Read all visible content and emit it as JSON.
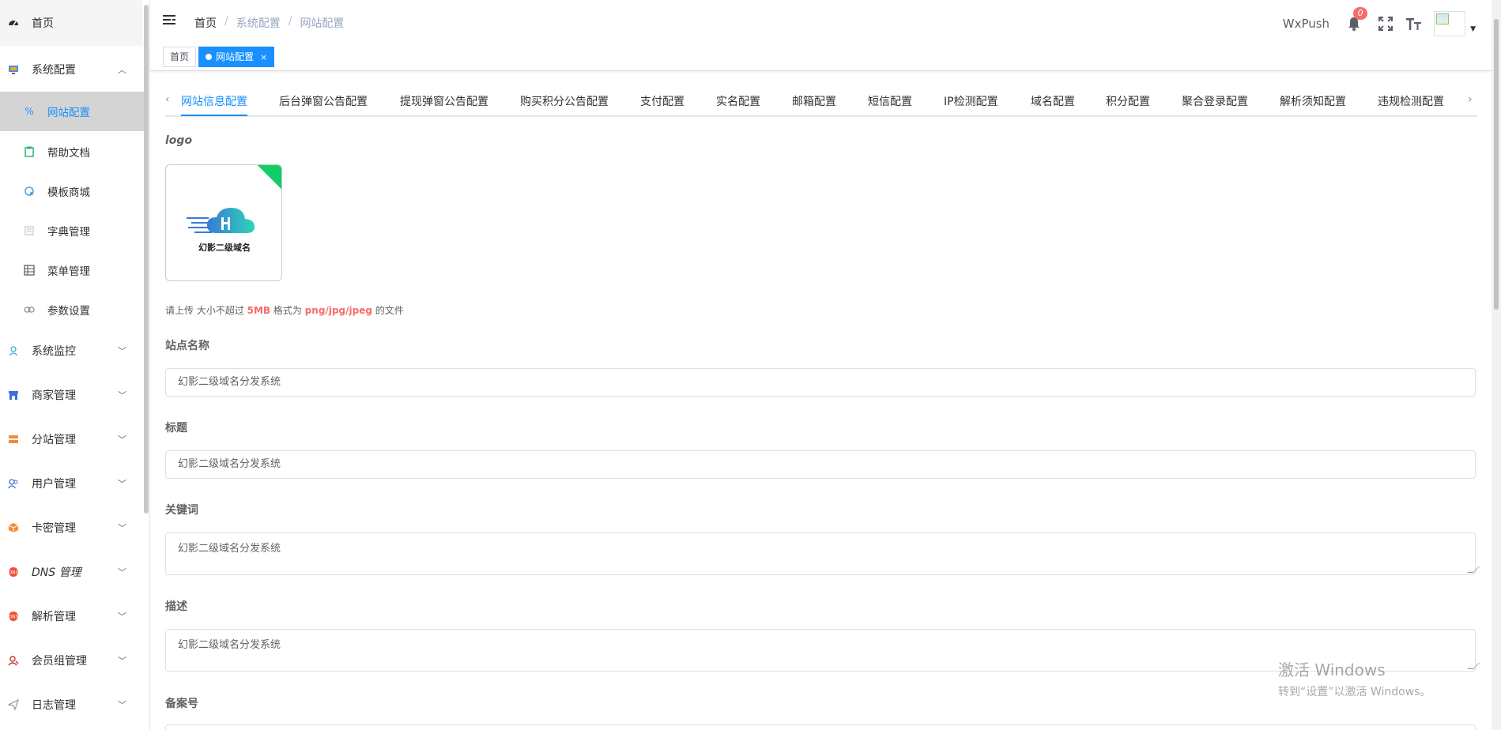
{
  "sidebar": {
    "items": [
      {
        "label": "首页",
        "icon": "dashboard-icon"
      },
      {
        "label": "系统配置",
        "icon": "monitor-icon",
        "expanded": true
      },
      {
        "label": "网站配置",
        "icon": "percent-icon",
        "active": true
      },
      {
        "label": "帮助文档",
        "icon": "clipboard-icon"
      },
      {
        "label": "模板商城",
        "icon": "shopping-icon"
      },
      {
        "label": "字典管理",
        "icon": "dictionary-icon"
      },
      {
        "label": "菜单管理",
        "icon": "table-icon"
      },
      {
        "label": "参数设置",
        "icon": "link-icon"
      },
      {
        "label": "系统监控",
        "icon": "monitor-user-icon"
      },
      {
        "label": "商家管理",
        "icon": "store-icon"
      },
      {
        "label": "分站管理",
        "icon": "server-icon"
      },
      {
        "label": "用户管理",
        "icon": "users-icon"
      },
      {
        "label": "卡密管理",
        "icon": "cube-icon"
      },
      {
        "label": "DNS 管理",
        "icon": "dns-icon"
      },
      {
        "label": "解析管理",
        "icon": "dns-resolve-icon"
      },
      {
        "label": "会员组管理",
        "icon": "member-icon"
      },
      {
        "label": "日志管理",
        "icon": "log-icon"
      }
    ]
  },
  "breadcrumb": [
    "首页",
    "系统配置",
    "网站配置"
  ],
  "header": {
    "wxpush": "WxPush",
    "badge": "0"
  },
  "tags": [
    {
      "label": "首页"
    },
    {
      "label": "网站配置",
      "close": "×"
    }
  ],
  "subtabs": [
    "网站信息配置",
    "后台弹窗公告配置",
    "提现弹窗公告配置",
    "购买积分公告配置",
    "支付配置",
    "实名配置",
    "邮箱配置",
    "短信配置",
    "IP检测配置",
    "域名配置",
    "积分配置",
    "聚合登录配置",
    "解析须知配置",
    "违规检测配置"
  ],
  "form": {
    "logo_label": "logo",
    "logo_text": "幻影二级域名",
    "hint": {
      "prefix": "请上传 大小不超过 ",
      "size": "5MB",
      "mid": " 格式为 ",
      "formats": "png/jpg/jpeg",
      "suffix": " 的文件"
    },
    "site_name_label": "站点名称",
    "site_name": "幻影二级域名分发系统",
    "title_label": "标题",
    "title": "幻影二级域名分发系统",
    "keywords_label": "关键词",
    "keywords": "幻影二级域名分发系统",
    "description_label": "描述",
    "description": "幻影二级域名分发系统",
    "icp_label": "备案号"
  },
  "watermark": {
    "line1": "激活 Windows",
    "line2": "转到“设置”以激活 Windows。"
  },
  "colors": {
    "primary": "#1890ff",
    "danger": "#f56c6c",
    "success": "#13ce66"
  }
}
